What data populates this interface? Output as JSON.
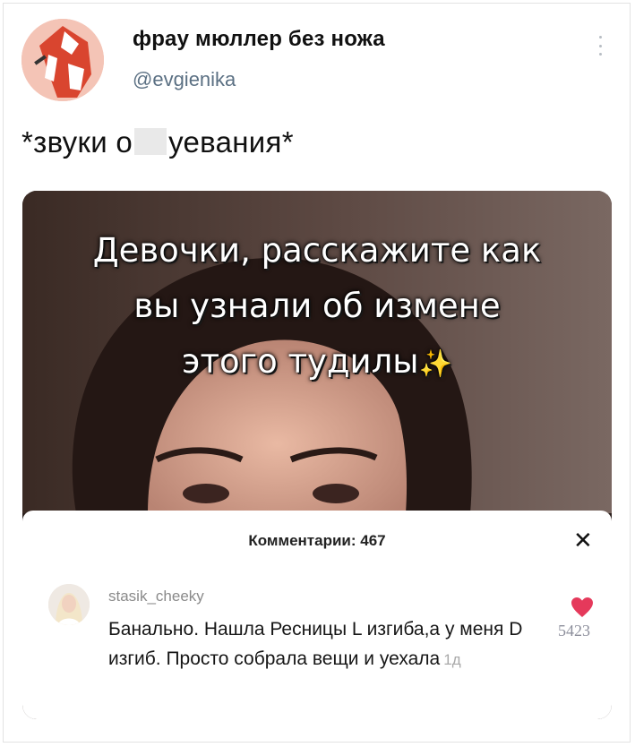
{
  "tweet": {
    "author_name": "фрау мюллер без ножа",
    "author_handle": "@evgienika",
    "text_before": "*звуки о",
    "text_after": "уевания*"
  },
  "media": {
    "overlay_lines": [
      "Девочки, расскажите как",
      "вы узнали об измене",
      "этого тудилы"
    ],
    "overlay_emoji": "✨"
  },
  "comments": {
    "title": "Комментарии: 467",
    "close_glyph": "✕",
    "comment": {
      "username": "stasik_cheeky",
      "text": "Банально. Нашла Ресницы L изгиба,а у меня D изгиб. Просто собрала вещи и уехала",
      "time": "1д",
      "likes": "5423"
    }
  },
  "colors": {
    "handle": "#5b7083",
    "heart": "#e5395b",
    "likes": "#8d8f9c"
  }
}
